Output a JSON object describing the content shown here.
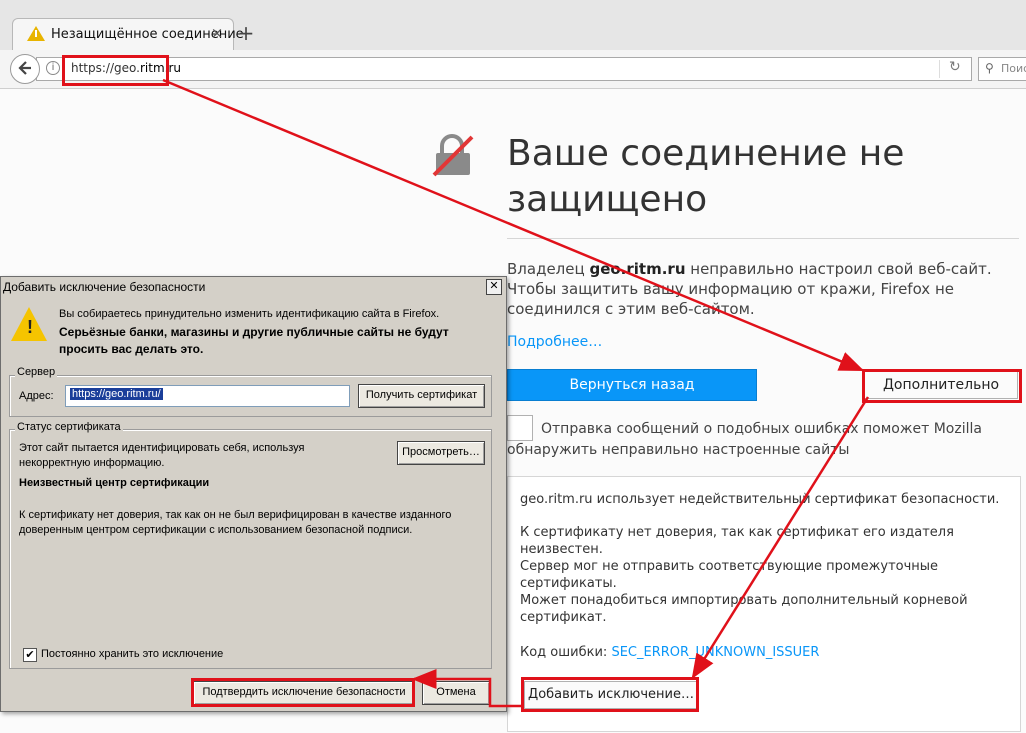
{
  "browser": {
    "tab_title": "Незащищённое соединение",
    "tab_close": "×",
    "new_tab": "+",
    "url_prefix": "https://geo.",
    "url_domain": "ritm.ru",
    "search_placeholder": "Поис"
  },
  "error_page": {
    "title": "Ваше соединение не защищено",
    "desc_prefix": "Владелец ",
    "desc_site": "geo.ritm.ru",
    "desc_suffix": " неправильно настроил свой веб-сайт. Чтобы защитить вашу информацию от кражи, Firefox не соединился с этим веб-сайтом.",
    "learn_more": "Подробнее…",
    "go_back": "Вернуться назад",
    "advanced": "Дополнительно",
    "report_text": "Отправка сообщений о подобных ошибках поможет Mozilla обнаружить неправильно настроенные сайты",
    "adv_line1": "geo.ritm.ru использует недействительный сертификат безопасности.",
    "adv_line2": "К сертификату нет доверия, так как сертификат его издателя неизвестен.",
    "adv_line3": "Сервер мог не отправить соответствующие промежуточные сертификаты.",
    "adv_line4": "Может понадобиться импортировать дополнительный корневой сертификат.",
    "error_code_label": "Код ошибки: ",
    "error_code": "SEC_ERROR_UNKNOWN_ISSUER",
    "add_exception": "Добавить исключение…"
  },
  "dialog": {
    "title": "Добавить исключение безопасности",
    "close": "✕",
    "intro": "Вы собираетесь принудительно изменить идентификацию сайта в Firefox.",
    "warning": "Серьёзные банки, магазины и другие публичные сайты не будут просить вас делать это.",
    "server_legend": "Сервер",
    "address_label": "Адрес:",
    "address_value": "https://geo.ritm.ru/",
    "get_certificate": "Получить сертификат",
    "status_legend": "Статус сертификата",
    "status_line1": "Этот сайт пытается идентифицировать себя, используя некорректную информацию.",
    "view": "Просмотреть…",
    "status_heading": "Неизвестный центр сертификации",
    "status_detail": "К сертификату нет доверия, так как он не был верифицирован в качестве изданного доверенным центром сертификации с использованием безопасной подписи.",
    "perm_checked": "✔",
    "perm_label": "Постоянно хранить это исключение",
    "confirm": "Подтвердить исключение безопасности",
    "cancel": "Отмена"
  },
  "colors": {
    "annotation": "#e0111a",
    "link_blue": "#0996f8"
  }
}
